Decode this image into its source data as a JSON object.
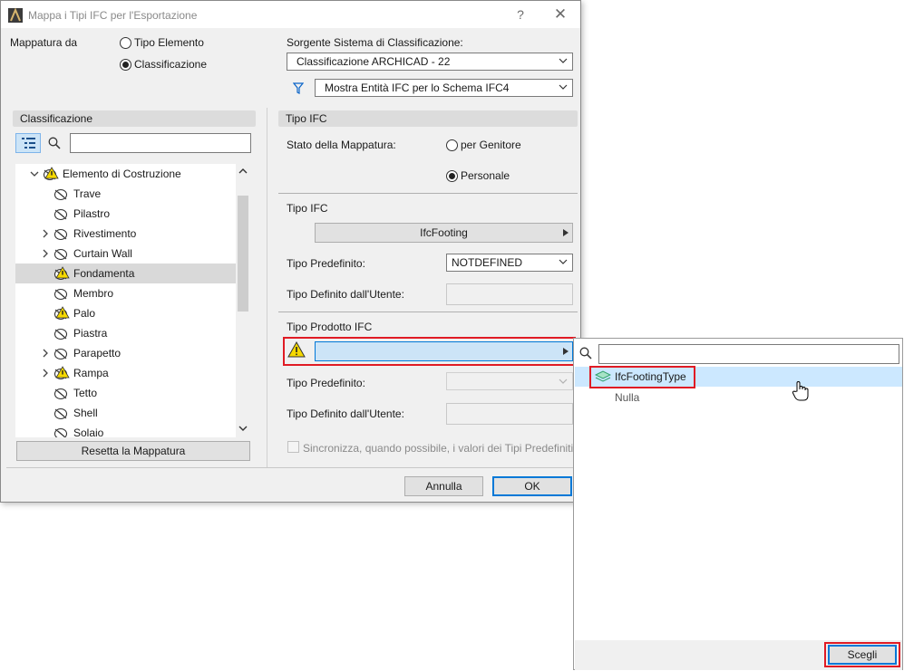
{
  "window": {
    "title": "Mappa i Tipi IFC per l'Esportazione",
    "help": "?",
    "close": "✕"
  },
  "mapping_from": {
    "label": "Mappatura da",
    "options": [
      {
        "label": "Tipo Elemento",
        "selected": false
      },
      {
        "label": "Classificazione",
        "selected": true
      }
    ]
  },
  "source": {
    "label": "Sorgente Sistema di Classificazione:",
    "value": "Classificazione ARCHICAD - 22",
    "filter_value": "Mostra Entità IFC per lo Schema IFC4"
  },
  "classification_panel": {
    "header": "Classificazione",
    "search_placeholder": "",
    "tree": [
      {
        "label": "Elemento di Costruzione",
        "level": 0,
        "expanded": true,
        "warning": true,
        "selected": false
      },
      {
        "label": "Trave",
        "level": 1,
        "expander": false,
        "warning": false,
        "selected": false
      },
      {
        "label": "Pilastro",
        "level": 1,
        "expander": false,
        "warning": false,
        "selected": false
      },
      {
        "label": "Rivestimento",
        "level": 1,
        "expander": true,
        "warning": false,
        "selected": false
      },
      {
        "label": "Curtain Wall",
        "level": 1,
        "expander": true,
        "warning": false,
        "selected": false
      },
      {
        "label": "Fondamenta",
        "level": 1,
        "expander": false,
        "warning": true,
        "selected": true
      },
      {
        "label": "Membro",
        "level": 1,
        "expander": false,
        "warning": false,
        "selected": false
      },
      {
        "label": "Palo",
        "level": 1,
        "expander": false,
        "warning": true,
        "selected": false
      },
      {
        "label": "Piastra",
        "level": 1,
        "expander": false,
        "warning": false,
        "selected": false
      },
      {
        "label": "Parapetto",
        "level": 1,
        "expander": true,
        "warning": false,
        "selected": false
      },
      {
        "label": "Rampa",
        "level": 1,
        "expander": true,
        "warning": true,
        "selected": false
      },
      {
        "label": "Tetto",
        "level": 1,
        "expander": false,
        "warning": false,
        "selected": false
      },
      {
        "label": "Shell",
        "level": 1,
        "expander": false,
        "warning": false,
        "selected": false
      },
      {
        "label": "Solaio",
        "level": 1,
        "expander": false,
        "warning": false,
        "selected": false
      }
    ],
    "reset_button": "Resetta la Mappatura"
  },
  "ifc_type_panel": {
    "header": "Tipo IFC",
    "mapping_state_label": "Stato della Mappatura:",
    "mapping_state_options": [
      {
        "label": "per Genitore",
        "selected": false
      },
      {
        "label": "Personale",
        "selected": true
      }
    ],
    "ifc_type_label": "Tipo IFC",
    "ifc_type_value": "IfcFooting",
    "predefined_label": "Tipo Predefinito:",
    "predefined_value": "NOTDEFINED",
    "user_defined_label": "Tipo Definito dall'Utente:",
    "user_defined_value": "",
    "product_label": "Tipo Prodotto IFC",
    "product_value": "",
    "product_predefined_label": "Tipo Predefinito:",
    "product_user_defined_label": "Tipo Definito dall'Utente:",
    "sync_label": "Sincronizza, quando possibile, i valori dei Tipi Predefiniti",
    "sync_checked": false
  },
  "footer": {
    "cancel": "Annulla",
    "ok": "OK"
  },
  "popup": {
    "search_value": "",
    "items": [
      {
        "label": "IfcFootingType",
        "selected": true
      },
      {
        "label": "Nulla",
        "selected": false
      }
    ],
    "choose_button": "Scegli"
  },
  "colors": {
    "accent": "#0078d7",
    "highlight_red": "#e01b24",
    "warning_yellow": "#f5d800",
    "popup_selection": "#cce8ff",
    "ifc_type_icon": "#2ea06b"
  }
}
